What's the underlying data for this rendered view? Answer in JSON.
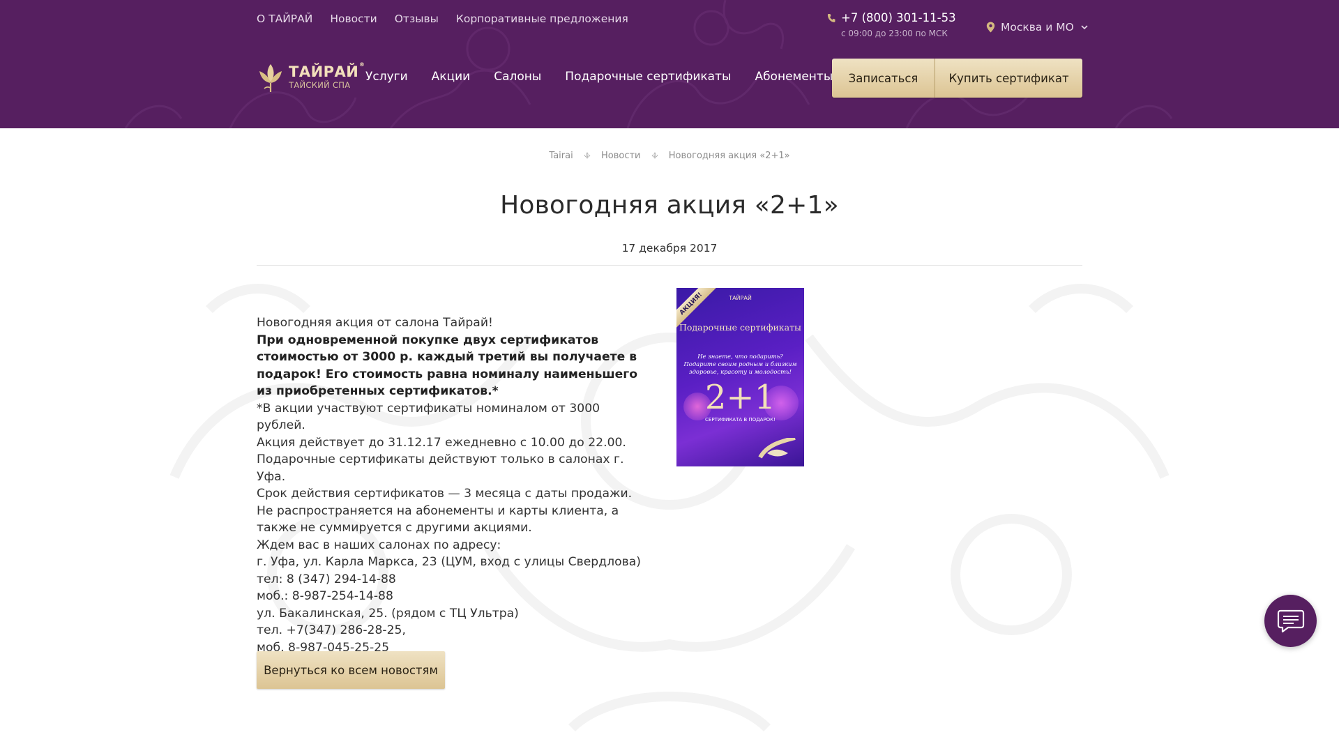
{
  "topnav": {
    "items": [
      {
        "label": "О ТАЙРАЙ"
      },
      {
        "label": "Новости"
      },
      {
        "label": "Отзывы"
      },
      {
        "label": "Корпоративные предложения"
      }
    ]
  },
  "contact": {
    "phone": "+7 (800) 301-11-53",
    "hours": "с 09:00 до 23:00 по МСК",
    "city": "Москва и МО"
  },
  "logo": {
    "name": "ТАЙРАЙ",
    "registered": "®",
    "subtitle": "ТАЙСКИЙ СПА"
  },
  "mainnav": {
    "items": [
      {
        "label": "Услуги"
      },
      {
        "label": "Акции"
      },
      {
        "label": "Салоны"
      },
      {
        "label": "Подарочные сертификаты"
      },
      {
        "label": "Абонементы"
      }
    ]
  },
  "header_buttons": {
    "book": "Записаться",
    "buy": "Купить сертификат"
  },
  "breadcrumb": {
    "items": [
      "Tairai",
      "Новости",
      "Новогодняя акция «2+1»"
    ]
  },
  "article": {
    "title": "Новогодняя акция «2+1»",
    "date": "17 декабря 2017",
    "intro": "Новогодняя акция от салона Тайрай!",
    "highlight": "При одновременной покупке двух сертификатов стоимостью от 3000 р. каждый третий вы получаете в подарок! Его стоимость равна номиналу наименьшего из приобретенных сертификатов.*",
    "lines": [
      "*В акции участвуют сертификаты номиналом от 3000 рублей.",
      "Акция действует до 31.12.17 ежедневно с 10.00 до 22.00.",
      "Подарочные сертификаты действуют только в салонах г. Уфа.",
      "Срок действия сертификатов — 3 месяца с даты продажи.",
      "Не распространяется на абонементы и карты клиента, а также не суммируется с другими акциями.",
      "Ждем вас в наших салонах по адресу:",
      "г. Уфа, ул. Карла Маркса, 23 (ЦУМ, вход с улицы Свердлова)",
      "тел: 8 (347) 294-14-88",
      "моб.: 8-987-254-14-88",
      "ул. Бакалинская, 25. (рядом с ТЦ Ультра)",
      "тел. +7(347) 286-28-25,",
      "моб. 8-987-045-25-25"
    ],
    "back_button": "Вернуться ко всем новостям"
  },
  "promo_image": {
    "ribbon": "АКЦИЯ!",
    "brand": "ТАЙРАЙ",
    "title": "Подарочные сертификаты",
    "subtitle": "Не знаете, что подарить? Подарите своим родным и близким здоровье, красоту и молодость!",
    "big": "2+1",
    "under": "СЕРТИФИКАТА   В ПОДАРОК!"
  },
  "colors": {
    "header_bg": "#561f60",
    "gold_button": "#dcc493",
    "chat_button": "#561f60"
  },
  "icons": {
    "phone": "phone-icon",
    "city": "map-pin-icon",
    "dropdown": "chevron-down-icon",
    "chat": "chat-bubble-icon",
    "breadcrumb_separator": "leaf-icon"
  }
}
